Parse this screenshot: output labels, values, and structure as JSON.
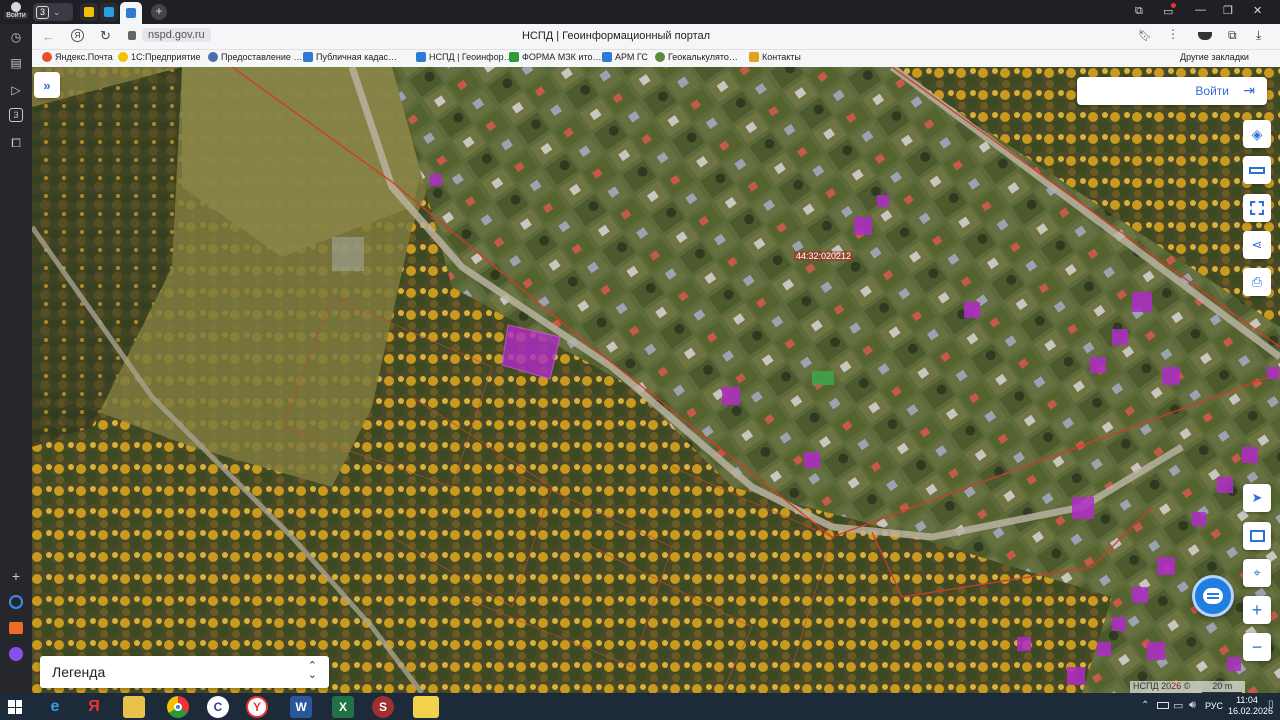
{
  "browser": {
    "profile_label": "Войти",
    "tab_count": "3",
    "active_tab_title": "НСПД | Геоинформационный портал",
    "url": "nspd.gov.ru"
  },
  "bookmarks": {
    "items": [
      {
        "label": "Яндекс.Почта",
        "color": "#e6502a"
      },
      {
        "label": "1С:Предприятие",
        "color": "#f2c200"
      },
      {
        "label": "Предоставление …",
        "color": "#4a6ea8"
      },
      {
        "label": "Публичная кадас…",
        "color": "#2e7bd6"
      },
      {
        "label": "НСПД | Геоинфор…",
        "color": "#2e7bd6"
      },
      {
        "label": "ФОРМА МЗК ито…",
        "color": "#2e9a3a"
      },
      {
        "label": "АРМ ГС",
        "color": "#2e7bd6"
      },
      {
        "label": "Геокалькулято…",
        "color": "#5a8a3a"
      },
      {
        "label": "Контакты",
        "color": "#e0a020"
      }
    ],
    "other_label": "Другие закладки"
  },
  "map": {
    "login_label": "Войти",
    "parcel_label": "44:32:020212",
    "legend_label": "Легенда",
    "attribution": "НСПД 2026 ©",
    "scale_label": "20 m",
    "colors": {
      "accent": "#2f6fd6",
      "parcel_border": "#d23a2a",
      "highlight": "#b02cc8"
    }
  },
  "taskbar": {
    "time": "11:04",
    "date": "16.02.2026",
    "lang": "РУС"
  }
}
